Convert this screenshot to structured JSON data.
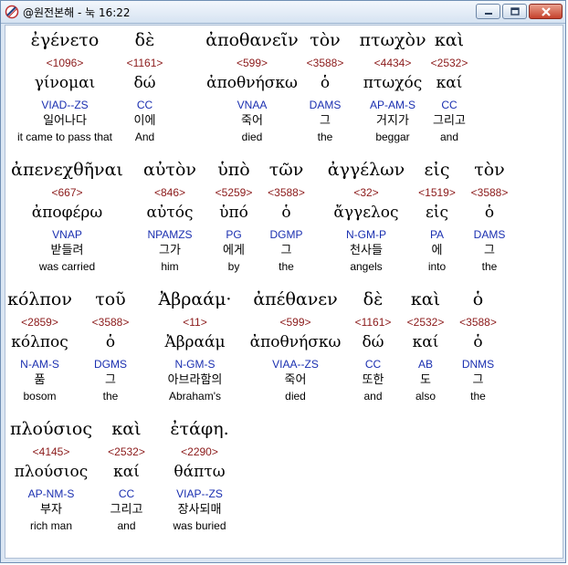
{
  "window": {
    "title": "@원전본해 - 눅 16:22"
  },
  "rows": [
    {
      "words": [
        {
          "greek": "ἐγένετο",
          "strong": "<1096>",
          "lemma": "γίνομαι",
          "morph": "VIAD--ZS",
          "korean": "일어나다",
          "english": "it came to pass that"
        },
        {
          "greek": "δὲ",
          "strong": "<1161>",
          "lemma": "δώ",
          "morph": "CC",
          "korean": "이에",
          "english": "And"
        },
        {
          "greek": "ἀποθανεῖν",
          "strong": "<599>",
          "lemma": "ἀποθνήσκω",
          "morph": "VNAA",
          "korean": "죽어",
          "english": "died"
        },
        {
          "greek": "τὸν",
          "strong": "<3588>",
          "lemma": "ὁ",
          "morph": "DAMS",
          "korean": "그",
          "english": "the"
        },
        {
          "greek": "πτωχὸν",
          "strong": "<4434>",
          "lemma": "πτωχός",
          "morph": "AP-AM-S",
          "korean": "거지가",
          "english": "beggar"
        },
        {
          "greek": "καὶ",
          "strong": "<2532>",
          "lemma": "καί",
          "morph": "CC",
          "korean": "그리고",
          "english": "and"
        }
      ]
    },
    {
      "words": [
        {
          "greek": "ἀπενεχθῆναι",
          "strong": "<667>",
          "lemma": "ἀποφέρω",
          "morph": "VNAP",
          "korean": "받들려",
          "english": "was carried"
        },
        {
          "greek": "αὐτὸν",
          "strong": "<846>",
          "lemma": "αὐτός",
          "morph": "NPAMZS",
          "korean": "그가",
          "english": "him"
        },
        {
          "greek": "ὑπὸ",
          "strong": "<5259>",
          "lemma": "ὑπό",
          "morph": "PG",
          "korean": "에게",
          "english": "by"
        },
        {
          "greek": "τῶν",
          "strong": "<3588>",
          "lemma": "ὁ",
          "morph": "DGMP",
          "korean": "그",
          "english": "the"
        },
        {
          "greek": "ἀγγέλων",
          "strong": "<32>",
          "lemma": "ἄγγελος",
          "morph": "N-GM-P",
          "korean": "천사들",
          "english": "angels"
        },
        {
          "greek": "εἰς",
          "strong": "<1519>",
          "lemma": "εἰς",
          "morph": "PA",
          "korean": "에",
          "english": "into"
        },
        {
          "greek": "τὸν",
          "strong": "<3588>",
          "lemma": "ὁ",
          "morph": "DAMS",
          "korean": "그",
          "english": "the"
        }
      ]
    },
    {
      "words": [
        {
          "greek": "κόλπον",
          "strong": "<2859>",
          "lemma": "κόλπος",
          "morph": "N-AM-S",
          "korean": "품",
          "english": "bosom"
        },
        {
          "greek": "τοῦ",
          "strong": "<3588>",
          "lemma": "ὁ",
          "morph": "DGMS",
          "korean": "그",
          "english": "the"
        },
        {
          "greek": "Ἀβραάμ·",
          "strong": "<11>",
          "lemma": "Ἀβραάμ",
          "morph": "N-GM-S",
          "korean": "아브라함의",
          "english": "Abraham's"
        },
        {
          "greek": "ἀπέθανεν",
          "strong": "<599>",
          "lemma": "ἀποθνήσκω",
          "morph": "VIAA--ZS",
          "korean": "죽어",
          "english": "died"
        },
        {
          "greek": "δὲ",
          "strong": "<1161>",
          "lemma": "δώ",
          "morph": "CC",
          "korean": "또한",
          "english": "and"
        },
        {
          "greek": "καὶ",
          "strong": "<2532>",
          "lemma": "καί",
          "morph": "AB",
          "korean": "도",
          "english": "also"
        },
        {
          "greek": "ὁ",
          "strong": "<3588>",
          "lemma": "ὁ",
          "morph": "DNMS",
          "korean": "그",
          "english": "the"
        }
      ]
    },
    {
      "words": [
        {
          "greek": "πλούσιος",
          "strong": "<4145>",
          "lemma": "πλούσιος",
          "morph": "AP-NM-S",
          "korean": "부자",
          "english": "rich man"
        },
        {
          "greek": "καὶ",
          "strong": "<2532>",
          "lemma": "καί",
          "morph": "CC",
          "korean": "그리고",
          "english": "and"
        },
        {
          "greek": "ἐτάφη.",
          "strong": "<2290>",
          "lemma": "θάπτω",
          "morph": "VIAP--ZS",
          "korean": "장사되매",
          "english": "was buried"
        }
      ]
    }
  ],
  "colors": {
    "strong": "#8b1a1a",
    "morph": "#1a2fb0",
    "highlight": "#3b6fc2"
  }
}
